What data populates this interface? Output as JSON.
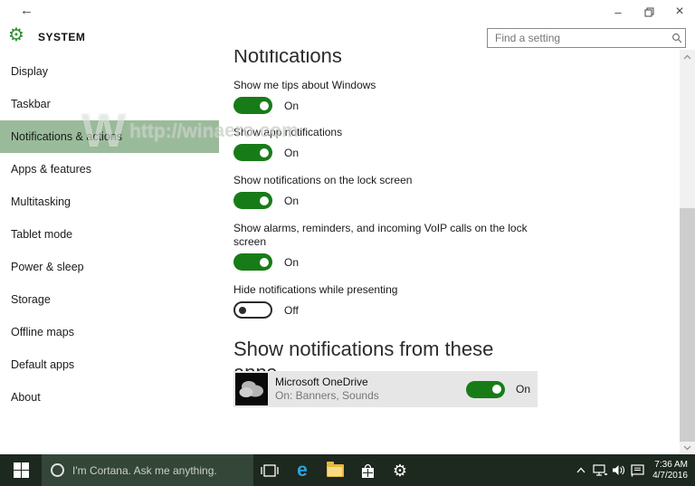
{
  "icons": {
    "back": "←",
    "minimize": "–",
    "close": "×",
    "app_gear": "⚙",
    "taskbar_gear": "⚙",
    "edge_logo": "e",
    "watermark_logo": "W"
  },
  "header": {
    "app_title": "SYSTEM",
    "search": {
      "placeholder": "Find a setting"
    }
  },
  "sidebar": {
    "items": [
      {
        "label": "Display",
        "selected": false
      },
      {
        "label": "Taskbar",
        "selected": false
      },
      {
        "label": "Notifications & actions",
        "selected": true
      },
      {
        "label": "Apps & features",
        "selected": false
      },
      {
        "label": "Multitasking",
        "selected": false
      },
      {
        "label": "Tablet mode",
        "selected": false
      },
      {
        "label": "Power & sleep",
        "selected": false
      },
      {
        "label": "Storage",
        "selected": false
      },
      {
        "label": "Offline maps",
        "selected": false
      },
      {
        "label": "Default apps",
        "selected": false
      },
      {
        "label": "About",
        "selected": false
      }
    ]
  },
  "watermark": {
    "text": "http://winaero.com"
  },
  "main": {
    "page_heading": "Notifications",
    "toggles": [
      {
        "label": "Show me tips about Windows",
        "state": "On"
      },
      {
        "label": "Show app notifications",
        "state": "On"
      },
      {
        "label": "Show notifications on the lock screen",
        "state": "On"
      },
      {
        "label": "Show alarms, reminders, and incoming VoIP calls on the lock screen",
        "state": "On"
      },
      {
        "label": "Hide notifications while presenting",
        "state": "Off"
      }
    ],
    "apps_section": {
      "heading": "Show notifications from these apps",
      "apps": [
        {
          "name": "Microsoft OneDrive",
          "detail": "On: Banners, Sounds",
          "state": "On"
        }
      ]
    }
  },
  "taskbar": {
    "cortana_placeholder": "I'm Cortana. Ask me anything.",
    "tray": {
      "time": "7:36 AM",
      "date": "4/7/2016"
    }
  },
  "colors": {
    "accent_green": "#177c17",
    "sidebar_selected": "#9abb9a",
    "taskbar_background": "#1d281f",
    "app_row_background": "#e6e6e6"
  }
}
